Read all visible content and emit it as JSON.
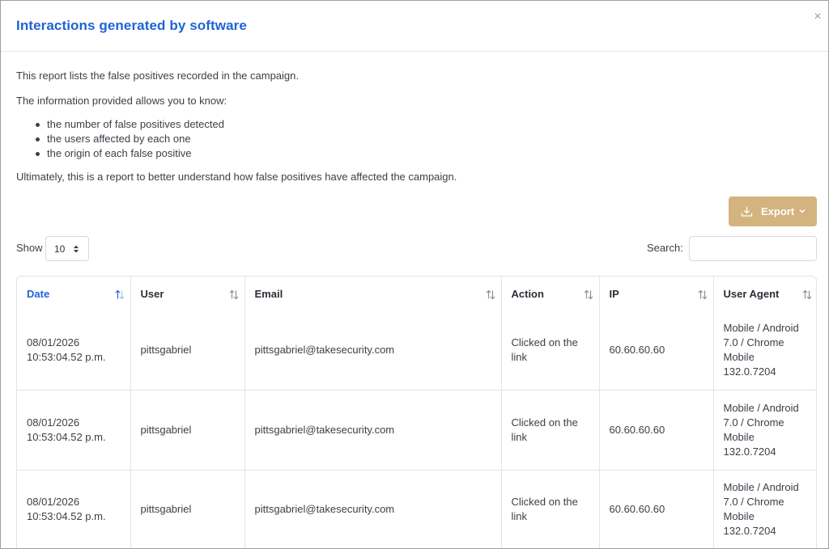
{
  "modal": {
    "title": "Interactions generated by software",
    "close_symbol": "×"
  },
  "intro": {
    "p1": "This report lists the false positives recorded in the campaign.",
    "p2": "The information provided allows you to know:",
    "bullets": [
      "the number of false positives detected",
      "the users affected by each one",
      "the origin of each false positive"
    ],
    "p3": "Ultimately, this is a report to better understand how false positives have affected the campaign."
  },
  "export": {
    "label": "Export",
    "icon": "download-icon",
    "chevron": "chevron-down-icon",
    "color": "#d3b47f"
  },
  "length": {
    "label": "Show",
    "value": "10"
  },
  "search": {
    "label": "Search:",
    "value": "",
    "placeholder": ""
  },
  "table": {
    "columns": [
      "Date",
      "User",
      "Email",
      "Action",
      "IP",
      "User Agent"
    ],
    "sorted_column": "Date",
    "rows": [
      {
        "date_1": "08/01/2026",
        "date_2": "10:53:04.52 p.m.",
        "user": "pittsgabriel",
        "email": "pittsgabriel@takesecurity.com",
        "action_1": "Clicked on the",
        "action_2": "link",
        "ip": "60.60.60.60",
        "ua_1": "Mobile / Android",
        "ua_2": "7.0 / Chrome",
        "ua_3": "Mobile",
        "ua_4": "132.0.7204"
      },
      {
        "date_1": "08/01/2026",
        "date_2": "10:53:04.52 p.m.",
        "user": "pittsgabriel",
        "email": "pittsgabriel@takesecurity.com",
        "action_1": "Clicked on the",
        "action_2": "link",
        "ip": "60.60.60.60",
        "ua_1": "Mobile / Android",
        "ua_2": "7.0 / Chrome",
        "ua_3": "Mobile",
        "ua_4": "132.0.7204"
      },
      {
        "date_1": "08/01/2026",
        "date_2": "10:53:04.52 p.m.",
        "user": "pittsgabriel",
        "email": "pittsgabriel@takesecurity.com",
        "action_1": "Clicked on the",
        "action_2": "link",
        "ip": "60.60.60.60",
        "ua_1": "Mobile / Android",
        "ua_2": "7.0 / Chrome",
        "ua_3": "Mobile",
        "ua_4": "132.0.7204"
      }
    ]
  },
  "colors": {
    "accent": "#1f63d6",
    "border": "#e1e4e8",
    "text": "#3a3f47"
  }
}
